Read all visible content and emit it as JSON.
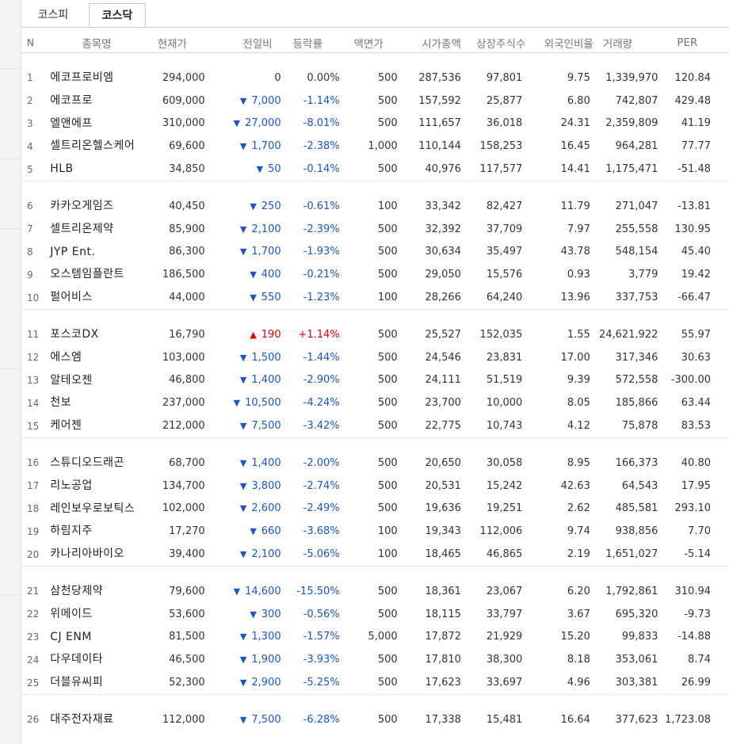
{
  "tabs": [
    {
      "label": "코스피",
      "selected": false
    },
    {
      "label": "코스닥",
      "selected": true
    }
  ],
  "columns": [
    "N",
    "종목명",
    "현재가",
    "전일비",
    "등락률",
    "액면가",
    "시가총액",
    "상장주식수",
    "외국인비율",
    "거래량",
    "PER"
  ],
  "colors": {
    "up": "#d00000",
    "down": "#1a56c8"
  },
  "rows": [
    {
      "n": "1",
      "name": "에코프로비엠",
      "price": "294,000",
      "dir": "zero",
      "change": "0",
      "rate": "0.00%",
      "face": "500",
      "cap": "287,536",
      "shares": "97,801",
      "foreign": "9.75",
      "volume": "1,339,970",
      "per": "120.84"
    },
    {
      "n": "2",
      "name": "에코프로",
      "price": "609,000",
      "dir": "down",
      "change": "7,000",
      "rate": "-1.14%",
      "face": "500",
      "cap": "157,592",
      "shares": "25,877",
      "foreign": "6.80",
      "volume": "742,807",
      "per": "429.48"
    },
    {
      "n": "3",
      "name": "엘앤에프",
      "price": "310,000",
      "dir": "down",
      "change": "27,000",
      "rate": "-8.01%",
      "face": "500",
      "cap": "111,657",
      "shares": "36,018",
      "foreign": "24.31",
      "volume": "2,359,809",
      "per": "41.19"
    },
    {
      "n": "4",
      "name": "셀트리온헬스케어",
      "price": "69,600",
      "dir": "down",
      "change": "1,700",
      "rate": "-2.38%",
      "face": "1,000",
      "cap": "110,144",
      "shares": "158,253",
      "foreign": "16.45",
      "volume": "964,281",
      "per": "77.77"
    },
    {
      "n": "5",
      "name": "HLB",
      "price": "34,850",
      "dir": "down",
      "change": "50",
      "rate": "-0.14%",
      "face": "500",
      "cap": "40,976",
      "shares": "117,577",
      "foreign": "14.41",
      "volume": "1,175,471",
      "per": "-51.48"
    },
    {
      "n": "6",
      "name": "카카오게임즈",
      "price": "40,450",
      "dir": "down",
      "change": "250",
      "rate": "-0.61%",
      "face": "100",
      "cap": "33,342",
      "shares": "82,427",
      "foreign": "11.79",
      "volume": "271,047",
      "per": "-13.81"
    },
    {
      "n": "7",
      "name": "셀트리온제약",
      "price": "85,900",
      "dir": "down",
      "change": "2,100",
      "rate": "-2.39%",
      "face": "500",
      "cap": "32,392",
      "shares": "37,709",
      "foreign": "7.97",
      "volume": "255,558",
      "per": "130.95"
    },
    {
      "n": "8",
      "name": "JYP Ent.",
      "price": "86,300",
      "dir": "down",
      "change": "1,700",
      "rate": "-1.93%",
      "face": "500",
      "cap": "30,634",
      "shares": "35,497",
      "foreign": "43.78",
      "volume": "548,154",
      "per": "45.40"
    },
    {
      "n": "9",
      "name": "오스템임플란트",
      "price": "186,500",
      "dir": "down",
      "change": "400",
      "rate": "-0.21%",
      "face": "500",
      "cap": "29,050",
      "shares": "15,576",
      "foreign": "0.93",
      "volume": "3,779",
      "per": "19.42"
    },
    {
      "n": "10",
      "name": "펄어비스",
      "price": "44,000",
      "dir": "down",
      "change": "550",
      "rate": "-1.23%",
      "face": "100",
      "cap": "28,266",
      "shares": "64,240",
      "foreign": "13.96",
      "volume": "337,753",
      "per": "-66.47"
    },
    {
      "n": "11",
      "name": "포스코DX",
      "price": "16,790",
      "dir": "up",
      "change": "190",
      "rate": "+1.14%",
      "face": "500",
      "cap": "25,527",
      "shares": "152,035",
      "foreign": "1.55",
      "volume": "24,621,922",
      "per": "55.97"
    },
    {
      "n": "12",
      "name": "에스엠",
      "price": "103,000",
      "dir": "down",
      "change": "1,500",
      "rate": "-1.44%",
      "face": "500",
      "cap": "24,546",
      "shares": "23,831",
      "foreign": "17.00",
      "volume": "317,346",
      "per": "30.63"
    },
    {
      "n": "13",
      "name": "알테오젠",
      "price": "46,800",
      "dir": "down",
      "change": "1,400",
      "rate": "-2.90%",
      "face": "500",
      "cap": "24,111",
      "shares": "51,519",
      "foreign": "9.39",
      "volume": "572,558",
      "per": "-300.00"
    },
    {
      "n": "14",
      "name": "천보",
      "price": "237,000",
      "dir": "down",
      "change": "10,500",
      "rate": "-4.24%",
      "face": "500",
      "cap": "23,700",
      "shares": "10,000",
      "foreign": "8.05",
      "volume": "185,866",
      "per": "63.44"
    },
    {
      "n": "15",
      "name": "케어젠",
      "price": "212,000",
      "dir": "down",
      "change": "7,500",
      "rate": "-3.42%",
      "face": "500",
      "cap": "22,775",
      "shares": "10,743",
      "foreign": "4.12",
      "volume": "75,878",
      "per": "83.53"
    },
    {
      "n": "16",
      "name": "스튜디오드래곤",
      "price": "68,700",
      "dir": "down",
      "change": "1,400",
      "rate": "-2.00%",
      "face": "500",
      "cap": "20,650",
      "shares": "30,058",
      "foreign": "8.95",
      "volume": "166,373",
      "per": "40.80"
    },
    {
      "n": "17",
      "name": "리노공업",
      "price": "134,700",
      "dir": "down",
      "change": "3,800",
      "rate": "-2.74%",
      "face": "500",
      "cap": "20,531",
      "shares": "15,242",
      "foreign": "42.63",
      "volume": "64,543",
      "per": "17.95"
    },
    {
      "n": "18",
      "name": "레인보우로보틱스",
      "price": "102,000",
      "dir": "down",
      "change": "2,600",
      "rate": "-2.49%",
      "face": "500",
      "cap": "19,636",
      "shares": "19,251",
      "foreign": "2.62",
      "volume": "485,581",
      "per": "293.10"
    },
    {
      "n": "19",
      "name": "하림지주",
      "price": "17,270",
      "dir": "down",
      "change": "660",
      "rate": "-3.68%",
      "face": "100",
      "cap": "19,343",
      "shares": "112,006",
      "foreign": "9.74",
      "volume": "938,856",
      "per": "7.70"
    },
    {
      "n": "20",
      "name": "카나리아바이오",
      "price": "39,400",
      "dir": "down",
      "change": "2,100",
      "rate": "-5.06%",
      "face": "100",
      "cap": "18,465",
      "shares": "46,865",
      "foreign": "2.19",
      "volume": "1,651,027",
      "per": "-5.14"
    },
    {
      "n": "21",
      "name": "삼천당제약",
      "price": "79,600",
      "dir": "down",
      "change": "14,600",
      "rate": "-15.50%",
      "face": "500",
      "cap": "18,361",
      "shares": "23,067",
      "foreign": "6.20",
      "volume": "1,792,861",
      "per": "310.94"
    },
    {
      "n": "22",
      "name": "위메이드",
      "price": "53,600",
      "dir": "down",
      "change": "300",
      "rate": "-0.56%",
      "face": "500",
      "cap": "18,115",
      "shares": "33,797",
      "foreign": "3.67",
      "volume": "695,320",
      "per": "-9.73"
    },
    {
      "n": "23",
      "name": "CJ ENM",
      "price": "81,500",
      "dir": "down",
      "change": "1,300",
      "rate": "-1.57%",
      "face": "5,000",
      "cap": "17,872",
      "shares": "21,929",
      "foreign": "15.20",
      "volume": "99,833",
      "per": "-14.88"
    },
    {
      "n": "24",
      "name": "다우데이타",
      "price": "46,500",
      "dir": "down",
      "change": "1,900",
      "rate": "-3.93%",
      "face": "500",
      "cap": "17,810",
      "shares": "38,300",
      "foreign": "8.18",
      "volume": "353,061",
      "per": "8.74"
    },
    {
      "n": "25",
      "name": "더블유씨피",
      "price": "52,300",
      "dir": "down",
      "change": "2,900",
      "rate": "-5.25%",
      "face": "500",
      "cap": "17,623",
      "shares": "33,697",
      "foreign": "4.96",
      "volume": "303,381",
      "per": "26.99"
    },
    {
      "n": "26",
      "name": "대주전자재료",
      "price": "112,000",
      "dir": "down",
      "change": "7,500",
      "rate": "-6.28%",
      "face": "500",
      "cap": "17,338",
      "shares": "15,481",
      "foreign": "16.64",
      "volume": "377,623",
      "per": "1,723.08"
    }
  ]
}
